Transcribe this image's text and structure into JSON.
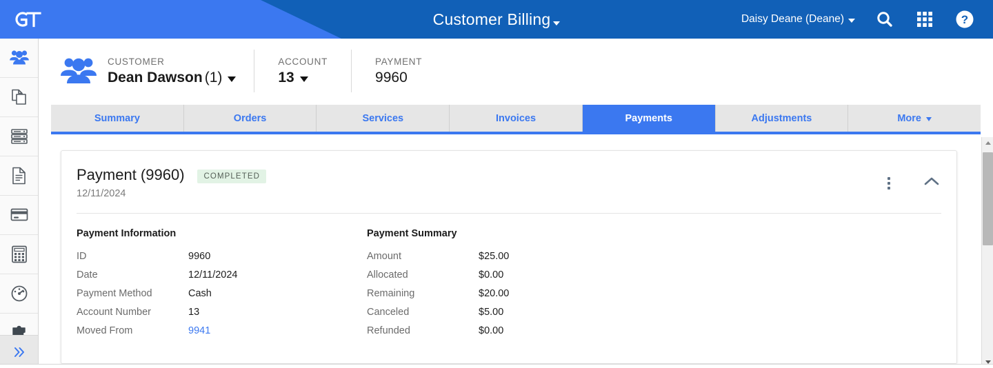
{
  "header": {
    "brand": "GT",
    "app_title": "Customer Billing",
    "user": "Daisy Deane (Deane)",
    "icons": {
      "search": "search-icon",
      "apps": "apps-grid-icon",
      "help": "help-circle-icon"
    },
    "colors": {
      "bar_dark": "#1160b7",
      "bar_light": "#3b78f0"
    }
  },
  "sidebar": {
    "items": [
      {
        "name": "customers",
        "icon": "people-icon",
        "active": true
      },
      {
        "name": "orders",
        "icon": "copy-pages-icon",
        "active": false
      },
      {
        "name": "services",
        "icon": "server-stack-icon",
        "active": false
      },
      {
        "name": "invoices",
        "icon": "document-icon",
        "active": false
      },
      {
        "name": "payments",
        "icon": "credit-card-icon",
        "active": false
      },
      {
        "name": "adjustments",
        "icon": "calculator-icon",
        "active": false
      },
      {
        "name": "dashboard",
        "icon": "gauge-icon",
        "active": false
      },
      {
        "name": "integrations",
        "icon": "puzzle-piece-icon",
        "active": false
      }
    ],
    "expand_label": "»"
  },
  "context": {
    "customer": {
      "label": "CUSTOMER",
      "name": "Dean Dawson",
      "count": "(1)"
    },
    "account": {
      "label": "ACCOUNT",
      "value": "13"
    },
    "payment": {
      "label": "PAYMENT",
      "value": "9960"
    }
  },
  "tabs": [
    {
      "label": "Summary",
      "active": false,
      "caret": false
    },
    {
      "label": "Orders",
      "active": false,
      "caret": false
    },
    {
      "label": "Services",
      "active": false,
      "caret": false
    },
    {
      "label": "Invoices",
      "active": false,
      "caret": false
    },
    {
      "label": "Payments",
      "active": true,
      "caret": false
    },
    {
      "label": "Adjustments",
      "active": false,
      "caret": false
    },
    {
      "label": "More",
      "active": false,
      "caret": true
    }
  ],
  "card": {
    "title": "Payment (9960)",
    "status_badge": "COMPLETED",
    "badge_bg": "#e2f3e5",
    "date": "12/11/2024",
    "info": {
      "section_title": "Payment Information",
      "rows": [
        {
          "key": "ID",
          "value": "9960",
          "link": false
        },
        {
          "key": "Date",
          "value": "12/11/2024",
          "link": false
        },
        {
          "key": "Payment Method",
          "value": "Cash",
          "link": false
        },
        {
          "key": "Account Number",
          "value": "13",
          "link": false
        },
        {
          "key": "Moved From",
          "value": "9941",
          "link": true
        }
      ]
    },
    "summary": {
      "section_title": "Payment Summary",
      "rows": [
        {
          "key": "Amount",
          "value": "$25.00"
        },
        {
          "key": "Allocated",
          "value": "$0.00"
        },
        {
          "key": "Remaining",
          "value": "$20.00"
        },
        {
          "key": "Canceled",
          "value": "$5.00"
        },
        {
          "key": "Refunded",
          "value": "$0.00"
        }
      ]
    }
  }
}
